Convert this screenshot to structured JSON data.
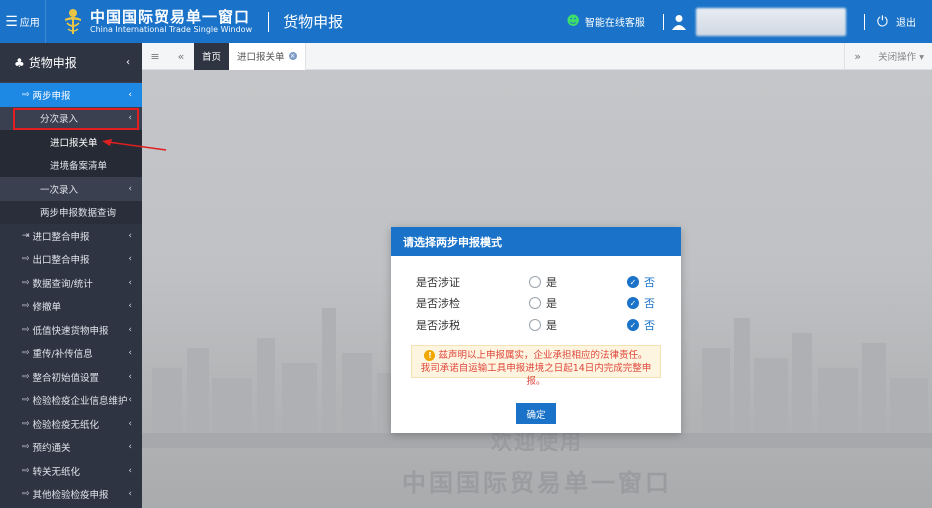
{
  "header": {
    "menu_label": "应用",
    "brand_cn": "中国国际贸易单一窗口",
    "brand_en": "China International Trade Single Window",
    "module": "货物申报",
    "service": "智能在线客服",
    "logout": "退出"
  },
  "sidebar": {
    "title": "货物申报",
    "items": [
      {
        "label": "两步申报"
      },
      {
        "label": "分次录入"
      },
      {
        "label": "进口报关单"
      },
      {
        "label": "进境备案清单"
      },
      {
        "label": "一次录入"
      },
      {
        "label": "两步申报数据查询"
      },
      {
        "label": "进口整合申报"
      },
      {
        "label": "出口整合申报"
      },
      {
        "label": "数据查询/统计"
      },
      {
        "label": "修撤单"
      },
      {
        "label": "低值快速货物申报"
      },
      {
        "label": "重传/补传信息"
      },
      {
        "label": "整合初始值设置"
      },
      {
        "label": "检验检疫企业信息维护"
      },
      {
        "label": "检验检疫无纸化"
      },
      {
        "label": "预约通关"
      },
      {
        "label": "转关无纸化"
      },
      {
        "label": "其他检验检疫申报"
      }
    ]
  },
  "tabs": {
    "home": "首页",
    "doc": "进口报关单",
    "close_ops": "关闭操作"
  },
  "content": {
    "welcome_line1": "欢迎使用",
    "welcome_line2": "中国国际贸易单一窗口"
  },
  "modal": {
    "title": "请选择两步申报模式",
    "questions": [
      {
        "label": "是否涉证",
        "yes": "是",
        "no": "否",
        "selected": "no"
      },
      {
        "label": "是否涉检",
        "yes": "是",
        "no": "否",
        "selected": "no"
      },
      {
        "label": "是否涉税",
        "yes": "是",
        "no": "否",
        "selected": "no"
      }
    ],
    "notice_line1": "兹声明以上申报属实，企业承担相应的法律责任。",
    "notice_line2": "我司承诺自运输工具申报进境之日起14日内完成完整申报。",
    "confirm": "确定"
  },
  "colors": {
    "header_bg": "#1a73c9",
    "sidebar_bg": "#2f3442",
    "active": "#1e88e5",
    "annotation": "#e02020"
  }
}
